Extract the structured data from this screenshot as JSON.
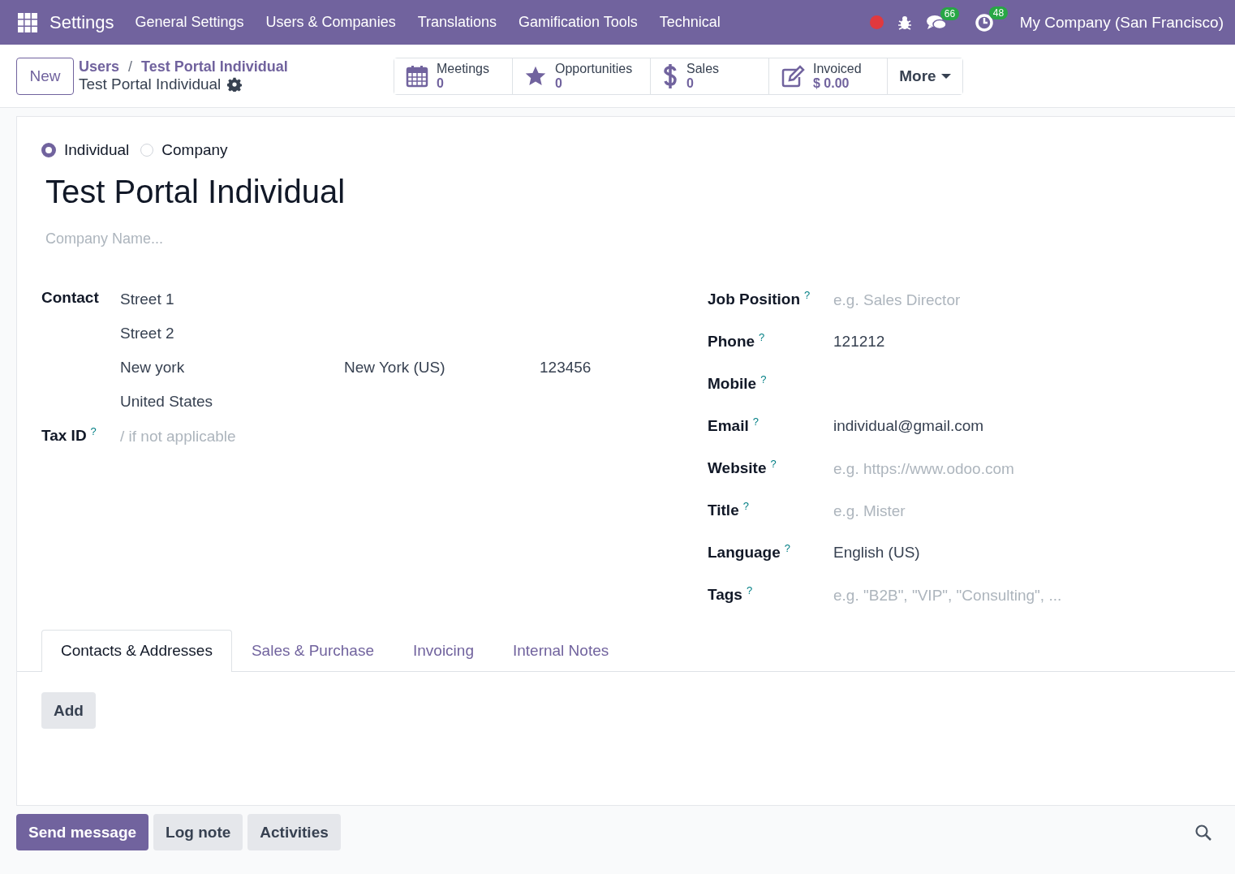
{
  "navbar": {
    "app_name": "Settings",
    "menus": [
      "General Settings",
      "Users & Companies",
      "Translations",
      "Gamification Tools",
      "Technical"
    ],
    "systray": [
      {
        "kind": "record",
        "color": "#e0393e"
      },
      {
        "kind": "debug"
      },
      {
        "kind": "messages",
        "badge": "66"
      },
      {
        "kind": "activities",
        "badge": "48"
      }
    ],
    "company": "My Company (San Francisco)"
  },
  "control_panel": {
    "new_button": "New",
    "breadcrumbs": [
      "Users",
      "Test Portal Individual"
    ],
    "breadcrumb_separator": "/",
    "record_title": "Test Portal Individual",
    "smart_buttons": [
      {
        "kind": "calendar",
        "label": "Meetings",
        "value": "0"
      },
      {
        "kind": "star",
        "label": "Opportunities",
        "value": "0"
      },
      {
        "kind": "dollar",
        "label": "Sales",
        "value": "0"
      },
      {
        "kind": "edit",
        "label": "Invoiced",
        "value": "$ 0.00"
      }
    ],
    "more_button": "More"
  },
  "form": {
    "company_type": [
      {
        "label": "Individual",
        "selected": true
      },
      {
        "label": "Company",
        "selected": false
      }
    ],
    "name": "Test Portal Individual",
    "company_name": {
      "placeholder": "Company Name..."
    },
    "contact": {
      "label": "Contact",
      "street": "Street 1",
      "street2": "Street 2",
      "city": "New york",
      "state": "New York (US)",
      "zip": "123456",
      "country": "United States"
    },
    "tax_id": {
      "label": "Tax ID",
      "help": "?",
      "placeholder": "/ if not applicable"
    },
    "right_fields": [
      {
        "label": "Job Position",
        "help": "?",
        "placeholder": "e.g. Sales Director"
      },
      {
        "label": "Phone",
        "help": "?",
        "value": "121212"
      },
      {
        "label": "Mobile",
        "help": "?"
      },
      {
        "label": "Email",
        "help": "?",
        "value": "individual@gmail.com"
      },
      {
        "label": "Website",
        "help": "?",
        "placeholder": "e.g. https://www.odoo.com"
      },
      {
        "label": "Title",
        "help": "?",
        "placeholder": "e.g. Mister"
      },
      {
        "label": "Language",
        "help": "?",
        "value": "English (US)"
      },
      {
        "label": "Tags",
        "help": "?",
        "placeholder": "e.g. \"B2B\", \"VIP\", \"Consulting\", ..."
      }
    ],
    "tabs": [
      {
        "label": "Contacts & Addresses",
        "selected": true
      },
      {
        "label": "Sales & Purchase",
        "selected": false
      },
      {
        "label": "Invoicing",
        "selected": false
      },
      {
        "label": "Internal Notes",
        "selected": false
      }
    ],
    "add_button": "Add"
  },
  "chatter": {
    "buttons": [
      {
        "label": "Send message",
        "primary": true
      },
      {
        "label": "Log note",
        "primary": false
      },
      {
        "label": "Activities",
        "primary": false
      }
    ]
  }
}
